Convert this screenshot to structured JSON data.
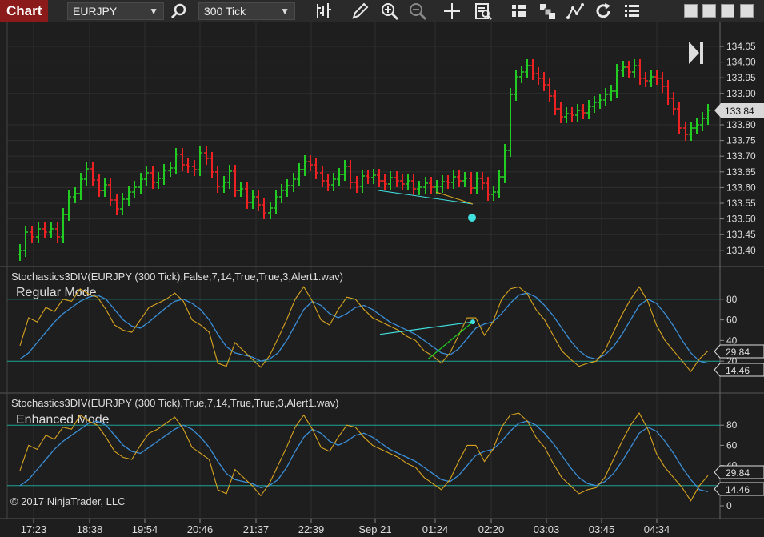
{
  "toolbar": {
    "chart_tab": "Chart",
    "instrument": "EURJPY",
    "interval": "300 Tick",
    "icons": [
      "search-icon",
      "bar-type-icon",
      "pencil-icon",
      "zoom-in-icon",
      "zoom-out-icon",
      "crosshair-icon",
      "data-box-icon",
      "indicators-icon",
      "strategies-icon",
      "drawing-tools-icon",
      "reload-icon",
      "properties-icon"
    ]
  },
  "price_panel": {
    "price_labels": [
      "134.05",
      "134.00",
      "133.95",
      "133.90",
      "133.84",
      "133.80",
      "133.75",
      "133.70",
      "133.65",
      "133.60",
      "133.55",
      "133.50",
      "133.45",
      "133.40"
    ],
    "last_price": "133.84",
    "last_price_color": "#1e1e1e"
  },
  "stoch_regular": {
    "title": "Stochastics3DIV(EURJPY (300 Tick),False,7,14,True,True,3,Alert1.wav)",
    "mode_label": "Regular Mode",
    "axis_labels": [
      "80",
      "60",
      "40",
      "20"
    ],
    "value_d": "29.84",
    "value_k": "14.46"
  },
  "stoch_enhanced": {
    "title": "Stochastics3DIV(EURJPY (300 Tick),True,7,14,True,True,3,Alert1.wav)",
    "mode_label": "Enhanced Mode",
    "axis_labels": [
      "80",
      "60",
      "40",
      "20",
      "0"
    ],
    "value_d": "29.84",
    "value_k": "14.46"
  },
  "time_axis": [
    "17:23",
    "18:38",
    "19:54",
    "20:46",
    "21:37",
    "22:39",
    "Sep 21",
    "01:24",
    "02:20",
    "03:03",
    "03:45",
    "04:34"
  ],
  "copyright": "© 2017 NinjaTrader, LLC",
  "colors": {
    "up_bar": "#22cc22",
    "down_bar": "#ee2222",
    "k_line": "#d9a520",
    "d_line": "#3a8fd9",
    "level_line": "#1fa39a",
    "divergence": "#40e0e0"
  }
}
